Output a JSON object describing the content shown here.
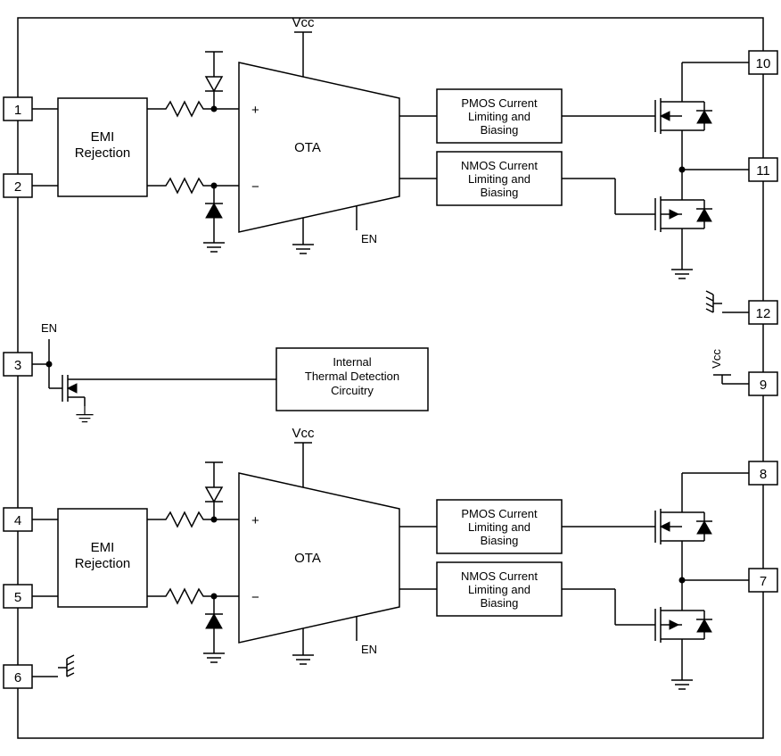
{
  "pins": {
    "p1": "1",
    "p2": "2",
    "p3": "3",
    "p4": "4",
    "p5": "5",
    "p6": "6",
    "p7": "7",
    "p8": "8",
    "p9": "9",
    "p10": "10",
    "p11": "11",
    "p12": "12"
  },
  "labels": {
    "vcc_top": "Vcc",
    "vcc_bot": "Vcc",
    "vcc_right": "Vcc",
    "en_top": "EN",
    "en_bot": "EN",
    "en_pin": "EN",
    "plus": "+",
    "minus": "−"
  },
  "blocks": {
    "emi_top_l1": "EMI",
    "emi_top_l2": "Rejection",
    "emi_bot_l1": "EMI",
    "emi_bot_l2": "Rejection",
    "ota_top": "OTA",
    "ota_bot": "OTA",
    "pmos_top_l1": "PMOS Current",
    "pmos_top_l2": "Limiting and",
    "pmos_top_l3": "Biasing",
    "nmos_top_l1": "NMOS Current",
    "nmos_top_l2": "Limiting and",
    "nmos_top_l3": "Biasing",
    "pmos_bot_l1": "PMOS Current",
    "pmos_bot_l2": "Limiting and",
    "pmos_bot_l3": "Biasing",
    "nmos_bot_l1": "NMOS Current",
    "nmos_bot_l2": "Limiting and",
    "nmos_bot_l3": "Biasing",
    "thermal_l1": "Internal",
    "thermal_l2": "Thermal Detection",
    "thermal_l3": "Circuitry"
  }
}
